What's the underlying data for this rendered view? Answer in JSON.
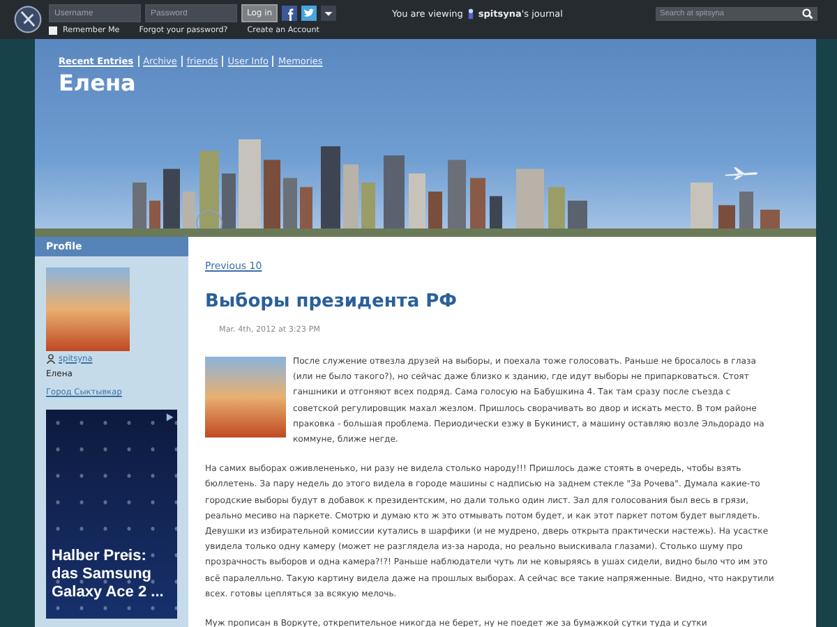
{
  "top_bar": {
    "username_placeholder": "Username",
    "password_placeholder": "Password",
    "login_button": "Log in",
    "remember_me": {
      "label": "Remember Me",
      "checked": false
    },
    "forgot_link": "Forgot your password?",
    "create_link": "Create an Account",
    "viewing_prefix": "You are viewing",
    "viewing_journal": "**spitsyna**'s journal",
    "search_placeholder": "Search at spitsyna"
  },
  "header": {
    "nav": [
      {
        "label": "Recent Entries",
        "selected": true
      },
      {
        "label": "Archive",
        "selected": false
      },
      {
        "label": "friends",
        "selected": false
      },
      {
        "label": "User Info",
        "selected": false
      },
      {
        "label": "Memories",
        "selected": false
      }
    ],
    "title": "Елена"
  },
  "sidebar": {
    "heading": "Profile",
    "username": "spitsyna",
    "name": "Елена",
    "city_link": "Город Сыктывкар",
    "ad_text": "Halber Preis: das Samsung Galaxy Ace 2 ..."
  },
  "main": {
    "previous_link": "Previous 10",
    "entry": {
      "title": "Выборы президента РФ",
      "date": "Mar. 4th, 2012 at 3:23 PM",
      "paragraphs": [
        "После служение отвезла друзей на выборы, и поехала тоже голосовать. Раньше не бросалось в глаза (или не было такого?), но сейчас даже близко к зданию, где идут выборы не припарковаться. Стоят ганшники и отгоняют всех подряд. Сама голосую на Бабушкина 4. Так там сразу после съезда с советской регулировщик махал жезлом. Пришлось сворачивать во двор и искать место. В том районе праковка - большая проблема. Периодически езжу в Букинист, а машину оставляю возле Эльдорадо на коммуне, ближе негде.",
        "На самих выборах оживлененько, ни разу не видела столько народу!!! Пришлось даже стоять в очередь, чтобы взять бюллетень. За пару недель до этого видела в городе машины с надписью на заднем стекле \"За Рочева\". Думала какие-то городские выборы будут в добавок к президентским, но дали только один лист. Зал для голосования был весь в грязи, реально месиво на паркете. Смотрю и думаю кто ж это отмывать потом будет, и как этот паркет потом будет выглядеть. Девушки из избирательной комиссии кутались в шарфики (и не мудрено, дверь открыта практически настежь). На усастке увидела только одну камеру (может не разглядела из-за народа, но реально выискивала глазами). Столько шуму про прозрачность выборов и одна камера?!?!  Раньше наблюдатели чуть ли не ковыряясь в ушах сидели, видно было что им это всё паралелльно. Такую картину видела даже на прошлых выборах. А сейчас все такие напряженные. Видно, что накрутили всех. готовы цепляться за всякую мелочь.",
        "Муж прописан в Воркуте, открепительное никогда не берет, ну не поедет же за бумажкой сутки туда и сутки"
      ]
    }
  }
}
